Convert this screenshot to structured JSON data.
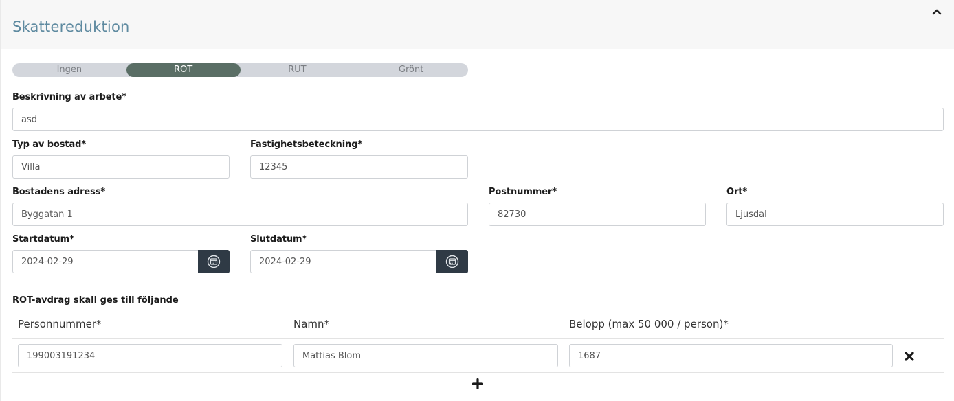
{
  "panel": {
    "title": "Skattereduktion"
  },
  "reduction_tabs": [
    {
      "label": "Ingen",
      "active": false
    },
    {
      "label": "ROT",
      "active": true
    },
    {
      "label": "RUT",
      "active": false
    },
    {
      "label": "Grönt",
      "active": false
    }
  ],
  "form": {
    "description": {
      "label": "Beskrivning av arbete*",
      "value": "asd"
    },
    "housing_type": {
      "label": "Typ av bostad*",
      "value": "Villa"
    },
    "property_designation": {
      "label": "Fastighetsbeteckning*",
      "value": "12345"
    },
    "address": {
      "label": "Bostadens adress*",
      "value": "Byggatan 1"
    },
    "postal_code": {
      "label": "Postnummer*",
      "value": "82730"
    },
    "city": {
      "label": "Ort*",
      "value": "Ljusdal"
    },
    "start_date": {
      "label": "Startdatum*",
      "value": "2024-02-29"
    },
    "end_date": {
      "label": "Slutdatum*",
      "value": "2024-02-29"
    }
  },
  "deduction": {
    "section_label": "ROT-avdrag skall ges till följande",
    "columns": {
      "personal_number": "Personnummer*",
      "name": "Namn*",
      "amount": "Belopp (max 50 000 / person)*"
    },
    "rows": [
      {
        "personal_number": "199003191234",
        "name": "Mattias Blom",
        "amount": "1687"
      }
    ]
  },
  "icons": {
    "collapse": "chevron-up-icon",
    "calendar": "calendar-icon",
    "remove": "close-icon",
    "add": "plus-icon"
  },
  "colors": {
    "title": "#5e8aa0",
    "active_tab": "#5a6e65",
    "calendar_button": "#2f3a45"
  }
}
